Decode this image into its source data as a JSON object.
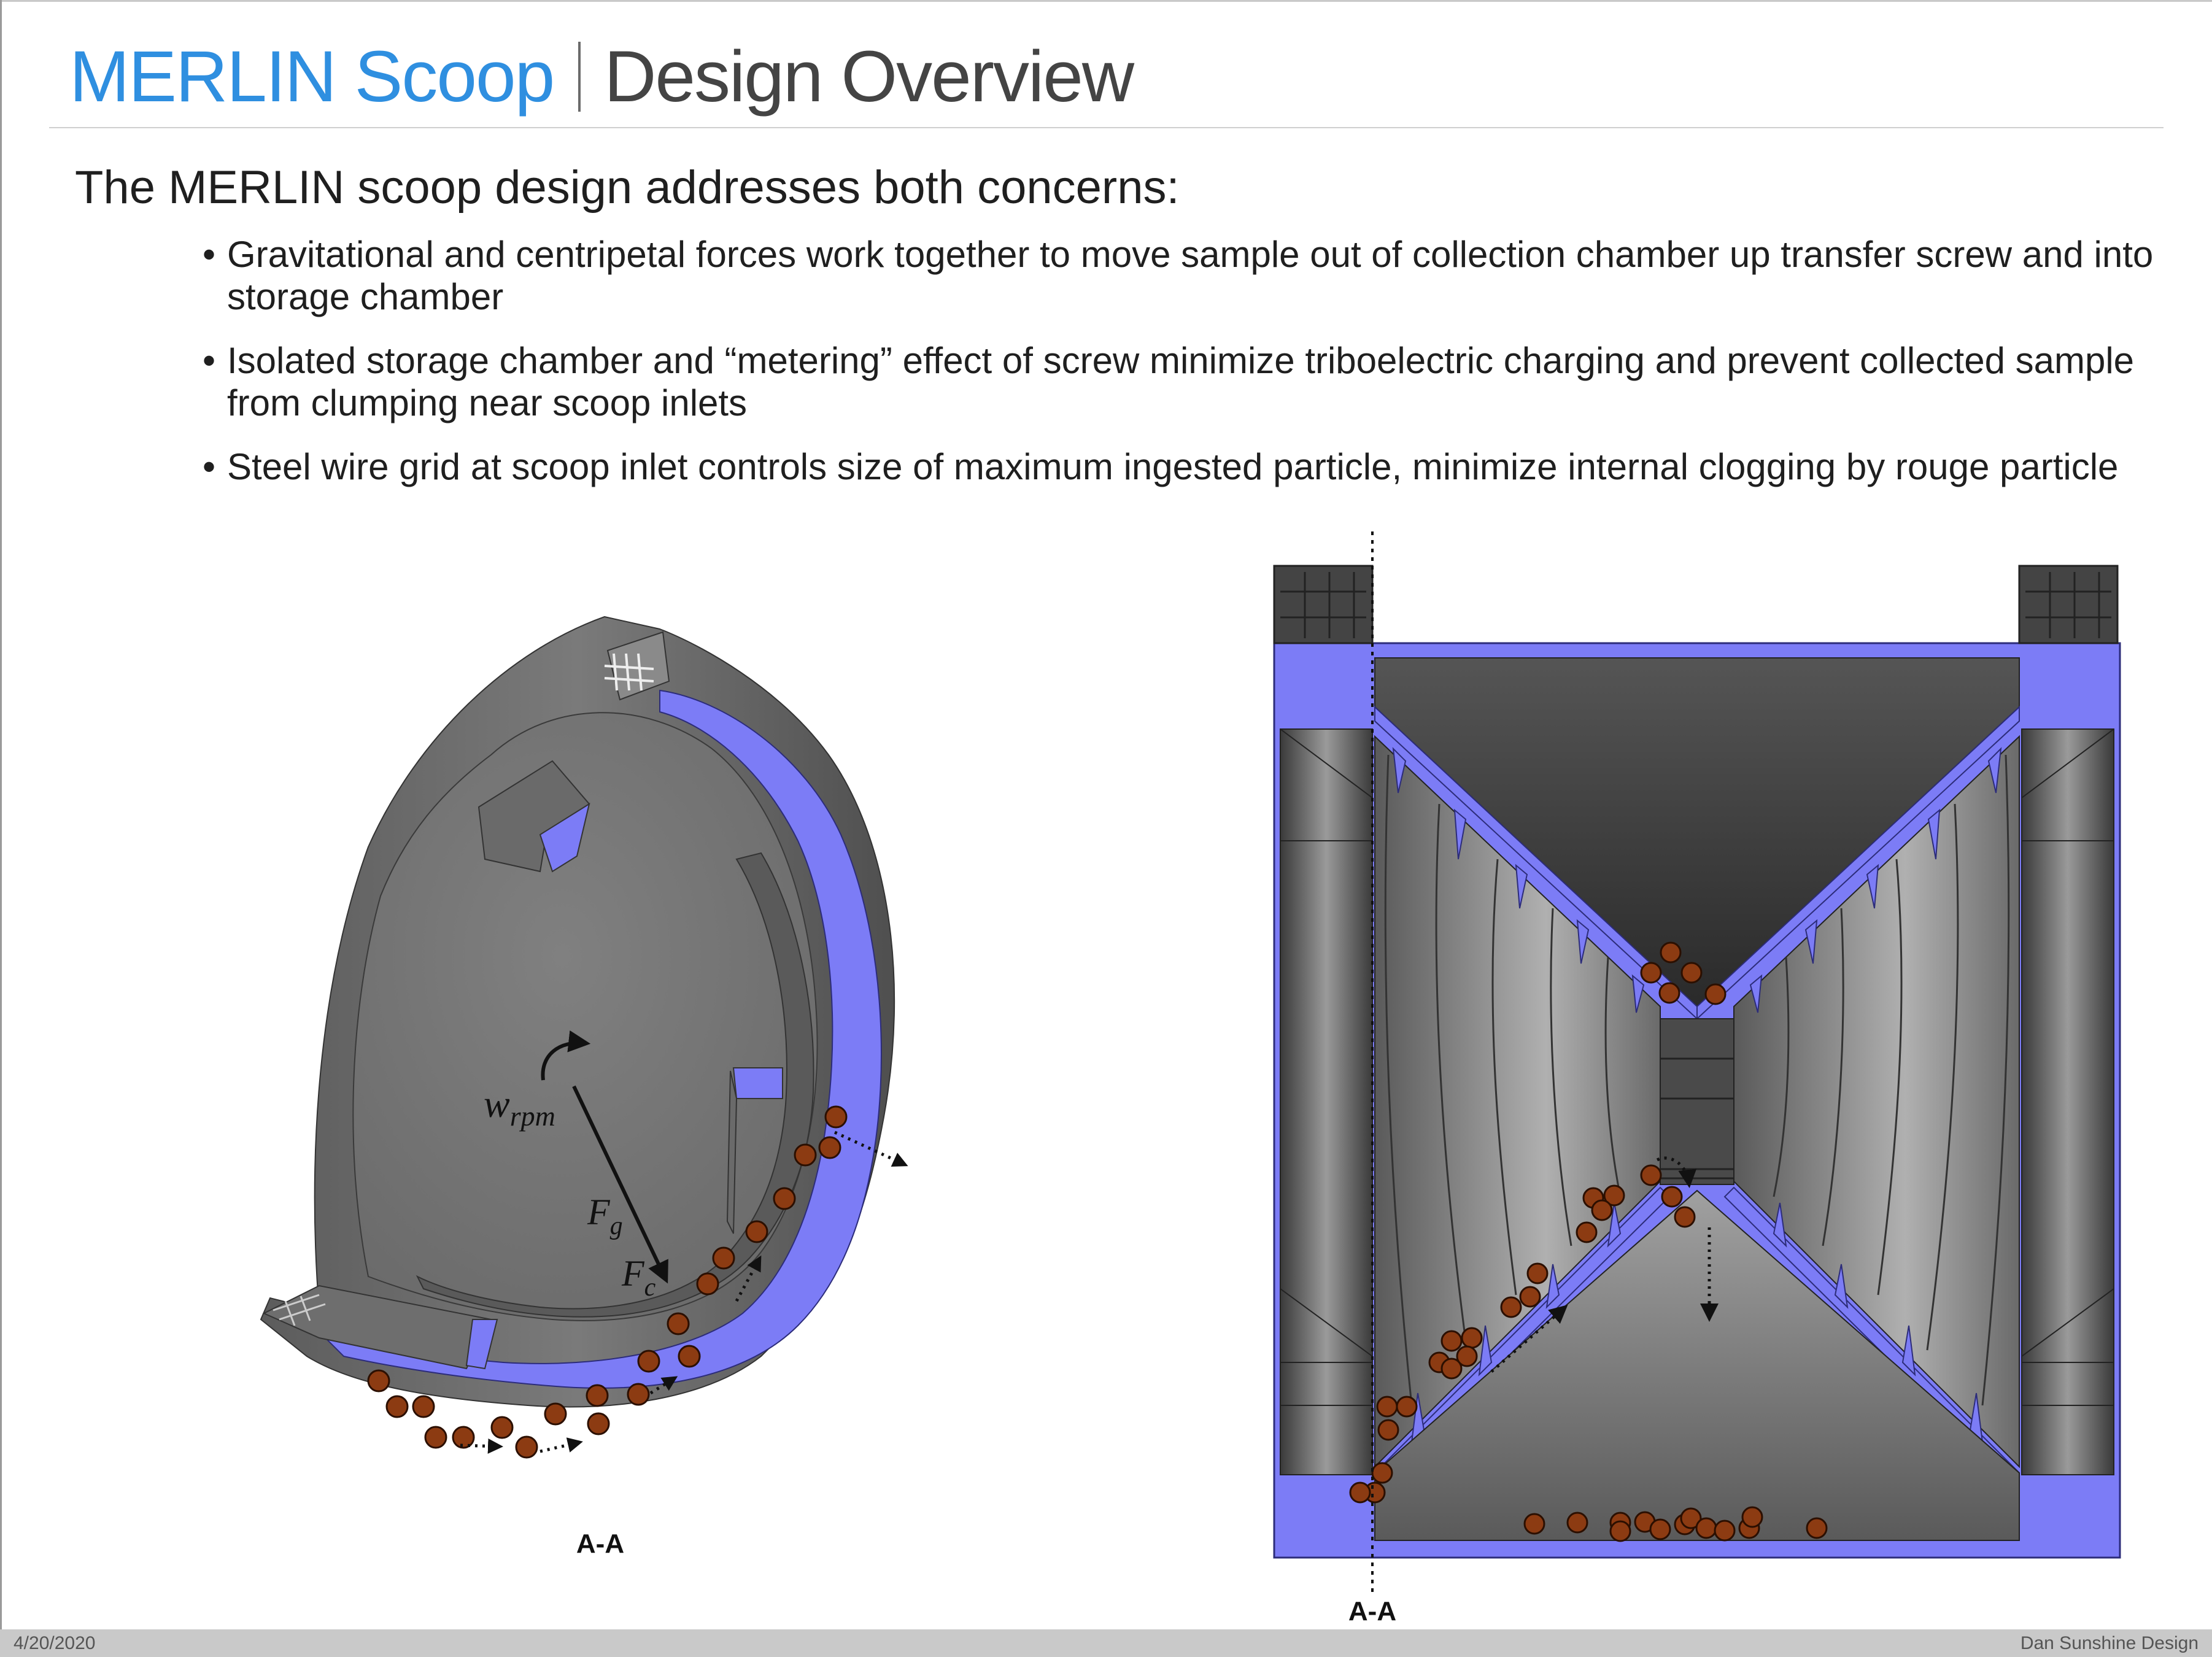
{
  "header": {
    "title_accent": "MERLIN Scoop",
    "title_main": "Design Overview"
  },
  "intro": "The MERLIN scoop design addresses both concerns:",
  "bullets": [
    "Gravitational and centripetal forces work together to move sample out of collection chamber up transfer screw and into storage chamber",
    "Isolated storage chamber and “metering” effect of screw minimize triboelectric charging and prevent collected sample from clumping near scoop inlets",
    "Steel wire grid at scoop inlet controls size of maximum ingested particle, minimize internal clogging by rouge particle"
  ],
  "left_diagram": {
    "section_label": "A-A",
    "omega_label": "w",
    "omega_sub": "rpm",
    "gravity_label": "F",
    "gravity_sub": "g",
    "centripetal_label": "F",
    "centripetal_sub": "c"
  },
  "right_diagram": {
    "section_label": "A-A"
  },
  "footer": {
    "date": "4/20/2020",
    "credit": "Dan Sunshine Design"
  },
  "colors": {
    "accent": "#2f8fe0",
    "body_gray": "#7a7a7a",
    "dark_gray": "#5a5a5a",
    "highlight": "#7c7cf6",
    "particle": "#8c3b12"
  }
}
